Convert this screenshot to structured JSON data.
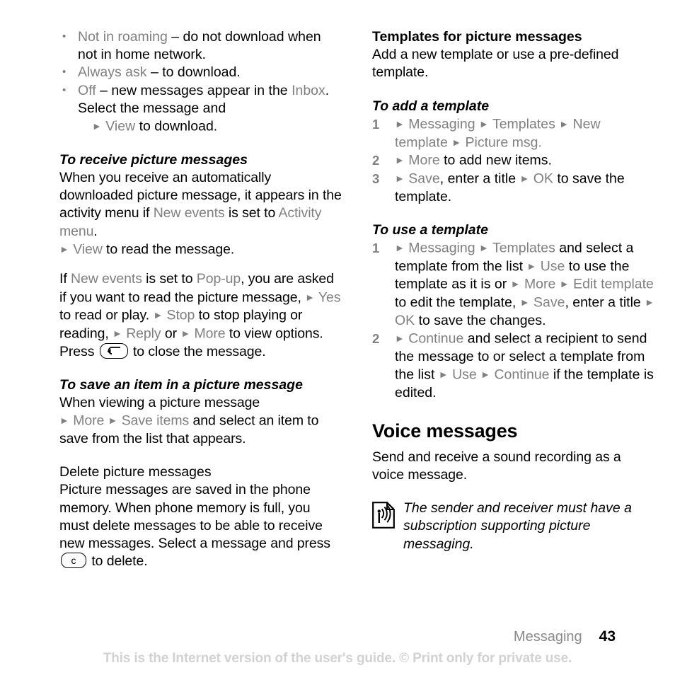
{
  "page": {
    "number": "43",
    "chapter": "Messaging",
    "disclaimer": "This is the Internet version of the user's guide. © Print only for private use."
  },
  "colors": {
    "ui_term": "#808080",
    "body": "#000000",
    "disclaimer": "#d2d2d2",
    "chapter": "#8a8a8a"
  },
  "left_column": {
    "bullets": [
      {
        "term": "Not in roaming",
        "rest": " – do not download when not in home network."
      },
      {
        "term": "Always ask",
        "rest": " – to download."
      },
      {
        "term": "Off",
        "rest": " – new messages appear in the ",
        "term2": "Inbox",
        "rest2": ". Select the message and",
        "sub_arrow": "►",
        "sub_term": "View",
        "sub_rest": " to download."
      }
    ],
    "receive_heading": "To receive picture messages",
    "receive_p1_a": "When you receive an automatically downloaded picture message, it appears in the activity menu if ",
    "receive_p1_term1": "New events",
    "receive_p1_b": " is set to ",
    "receive_p1_term2": "Activity menu",
    "receive_p1_c": ".",
    "receive_p1_arrow": "►",
    "receive_p1_term3": "View",
    "receive_p1_d": " to read the message.",
    "receive_p2_a": "If ",
    "receive_p2_term1": "New events",
    "receive_p2_b": " is set to ",
    "receive_p2_term2": "Pop-up",
    "receive_p2_c": ", you are asked if you want to read the picture message, ",
    "receive_p2_arrow1": "►",
    "receive_p2_term3": "Yes",
    "receive_p2_d": " to read or play. ",
    "receive_p2_arrow2": "►",
    "receive_p2_term4": "Stop",
    "receive_p2_e": " to stop playing or reading, ",
    "receive_p2_arrow3": "►",
    "receive_p2_term5": "Reply",
    "receive_p2_f": " or ",
    "receive_p2_arrow4": "►",
    "receive_p2_term6": "More",
    "receive_p2_g": " to view options. Press ",
    "receive_p2_key": "back-key",
    "receive_p2_h": " to close the message.",
    "save_heading": "To save an item in a picture message",
    "save_p_a": "When viewing a picture message",
    "save_p_arrow1": "►",
    "save_p_term1": "More",
    "save_p_arrow2": "►",
    "save_p_term2": "Save items",
    "save_p_b": " and select an item to save from the list that appears.",
    "delete_heading": "Delete picture messages",
    "delete_p_a": "Picture messages are saved in the phone memory. When phone memory is full, you must delete messages to be able to receive new messages. Select a message and press ",
    "delete_p_key": "clear-key",
    "delete_p_key_label": "c",
    "delete_p_b": " to delete."
  },
  "right_column": {
    "templates_heading": "Templates for picture messages",
    "templates_intro": "Add a new template or use a pre-defined template.",
    "add_heading": "To add a template",
    "add_steps": [
      {
        "arrow1": "►",
        "term1": "Messaging",
        "arrow2": "►",
        "term2": "Templates",
        "arrow3": "►",
        "term3": "New template",
        "arrow4": "►",
        "term4": "Picture msg",
        "tail": "."
      },
      {
        "arrow1": "►",
        "term1": "More",
        "tail": " to add new items."
      },
      {
        "arrow1": "►",
        "term1": "Save",
        "mid1": ", enter a title ",
        "arrow2": "►",
        "term2": "OK",
        "tail": " to save the template."
      }
    ],
    "use_heading": "To use a template",
    "use_steps": [
      {
        "arrow1": "►",
        "term1": "Messaging",
        "arrow2": "►",
        "term2": "Templates",
        "mid1": " and select a template from the list ",
        "arrow3": "►",
        "term3": "Use",
        "mid2": " to use the template as it is or ",
        "arrow4": "►",
        "term4": "More",
        "arrow5": "►",
        "term5": "Edit template",
        "mid3": " to edit the template, ",
        "arrow6": "►",
        "term6": "Save",
        "mid4": ", enter a title ",
        "arrow7": "►",
        "term7": "OK",
        "tail": " to save the changes."
      },
      {
        "arrow1": "►",
        "term1": "Continue",
        "mid1": " and select a recipient to send the message to or select a template from the list ",
        "arrow2": "►",
        "term2": "Use",
        "arrow3": "►",
        "term3": "Continue",
        "tail": " if the template is edited."
      }
    ],
    "voice_heading": "Voice messages",
    "voice_intro": "Send and receive a sound recording as a voice message.",
    "note_icon": "picture-message-note-icon",
    "note_text": "The sender and receiver must have a subscription supporting picture messaging."
  }
}
